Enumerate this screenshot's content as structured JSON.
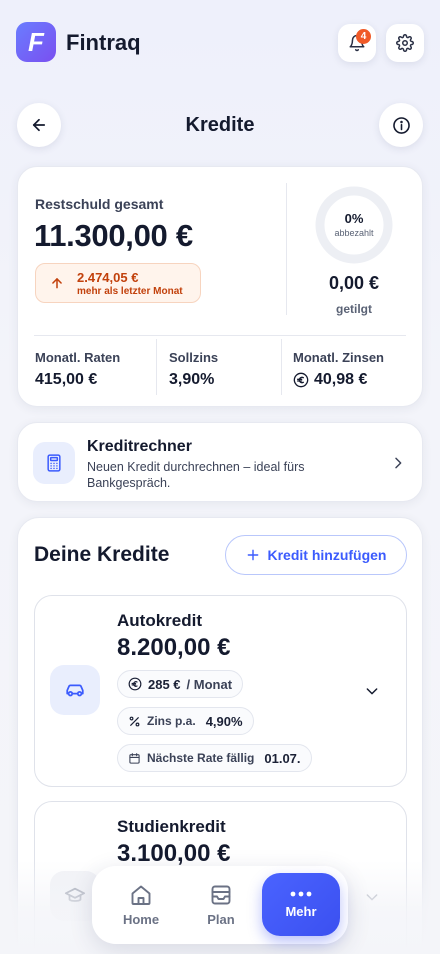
{
  "app": {
    "name": "Fintraq",
    "logo_letter": "F",
    "notification_count": "4"
  },
  "page": {
    "title": "Kredite"
  },
  "summary": {
    "label": "Restschuld gesamt",
    "total": "11.300,00 €",
    "change_value": "2.474,05 €",
    "change_text": "mehr als letzter Monat",
    "progress_percent": "0%",
    "progress_fraction": 0,
    "progress_label": "abbezahlt",
    "paid_value": "0,00 €",
    "paid_label": "getilgt",
    "stats": [
      {
        "label": "Monatl. Raten",
        "value": "415,00 €"
      },
      {
        "label": "Sollzins",
        "value": "3,90%"
      },
      {
        "label": "Monatl. Zinsen",
        "value": "40,98 €"
      }
    ]
  },
  "calculator": {
    "title": "Kreditrechner",
    "description": "Neuen Kredit durchrechnen – ideal fürs Bankgespräch."
  },
  "loans_section": {
    "title": "Deine Kredite",
    "add_button": "Kredit hinzufügen"
  },
  "loans": [
    {
      "name": "Autokredit",
      "amount": "8.200,00 €",
      "rate": "285 €",
      "rate_unit": "/ Monat",
      "interest_label": "Zins p.a.",
      "interest_value": "4,90%",
      "next_label": "Nächste Rate fällig",
      "next_value": "01.07."
    },
    {
      "name": "Studienkredit",
      "amount": "3.100,00 €"
    }
  ],
  "bottom_nav": [
    {
      "label": "Home"
    },
    {
      "label": "Plan"
    },
    {
      "label": "Mehr"
    }
  ],
  "colors": {
    "accent": "#3b5bfd",
    "danger": "#c2410c",
    "danger_bg": "#fff4ec"
  }
}
